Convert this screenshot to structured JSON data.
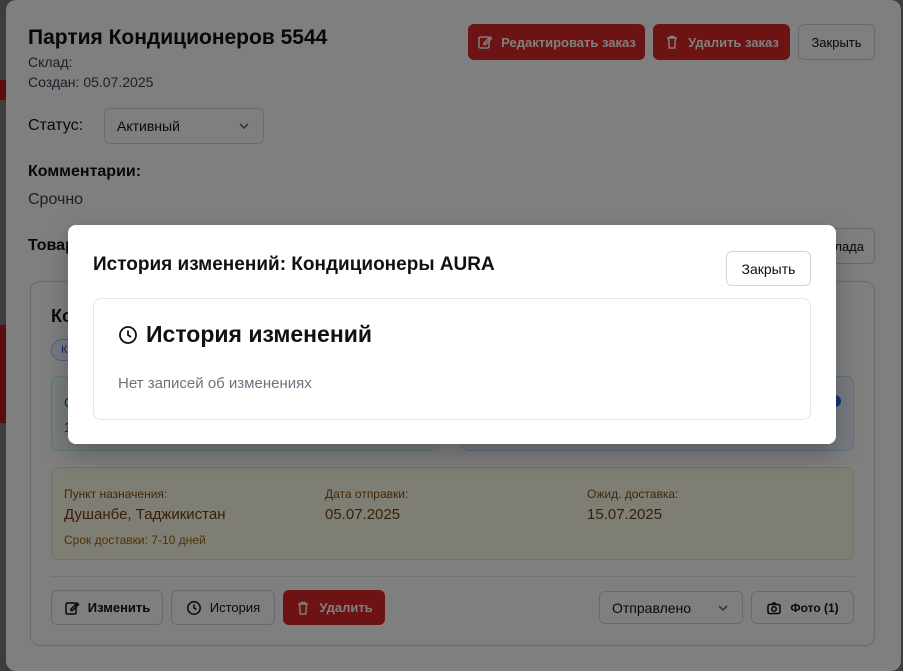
{
  "order": {
    "title": "Партия Кондиционеров 5544",
    "warehouse_label": "Склад:",
    "created_label": "Создан: 05.07.2025",
    "edit_button": "Редактировать заказ",
    "delete_button": "Удалить заказ",
    "close_button": "Закрыть",
    "status_label": "Статус:",
    "status_value": "Активный",
    "comments_label": "Комментарии:",
    "comment_text": "Срочно",
    "goods_label_partial": "Товар",
    "add_partial": "лада"
  },
  "card": {
    "title_partial": "Ко",
    "tag_partial": "К",
    "box1_a": "С",
    "box1_b": "1",
    "destination": {
      "label": "Пункт назначения:",
      "value": "Душанбе, Таджикистан",
      "delivery_note": "Срок доставки: 7-10 дней"
    },
    "ship_date": {
      "label": "Дата отправки:",
      "value": "05.07.2025"
    },
    "eta": {
      "label": "Ожид. доставка:",
      "value": "15.07.2025"
    },
    "edit_button": "Изменить",
    "history_button": "История",
    "delete_button": "Удалить",
    "shipment_status": "Отправлено",
    "photo_button": "Фото (1)"
  },
  "history_modal": {
    "title": "История изменений: Кондиционеры AURA",
    "close_button": "Закрыть",
    "heading": "История изменений",
    "empty_text": "Нет записей об изменениях"
  },
  "colors": {
    "danger": "#dc2626",
    "overlay": "rgba(0,0,0,0.5)",
    "destination_bg": "#fefce8"
  }
}
